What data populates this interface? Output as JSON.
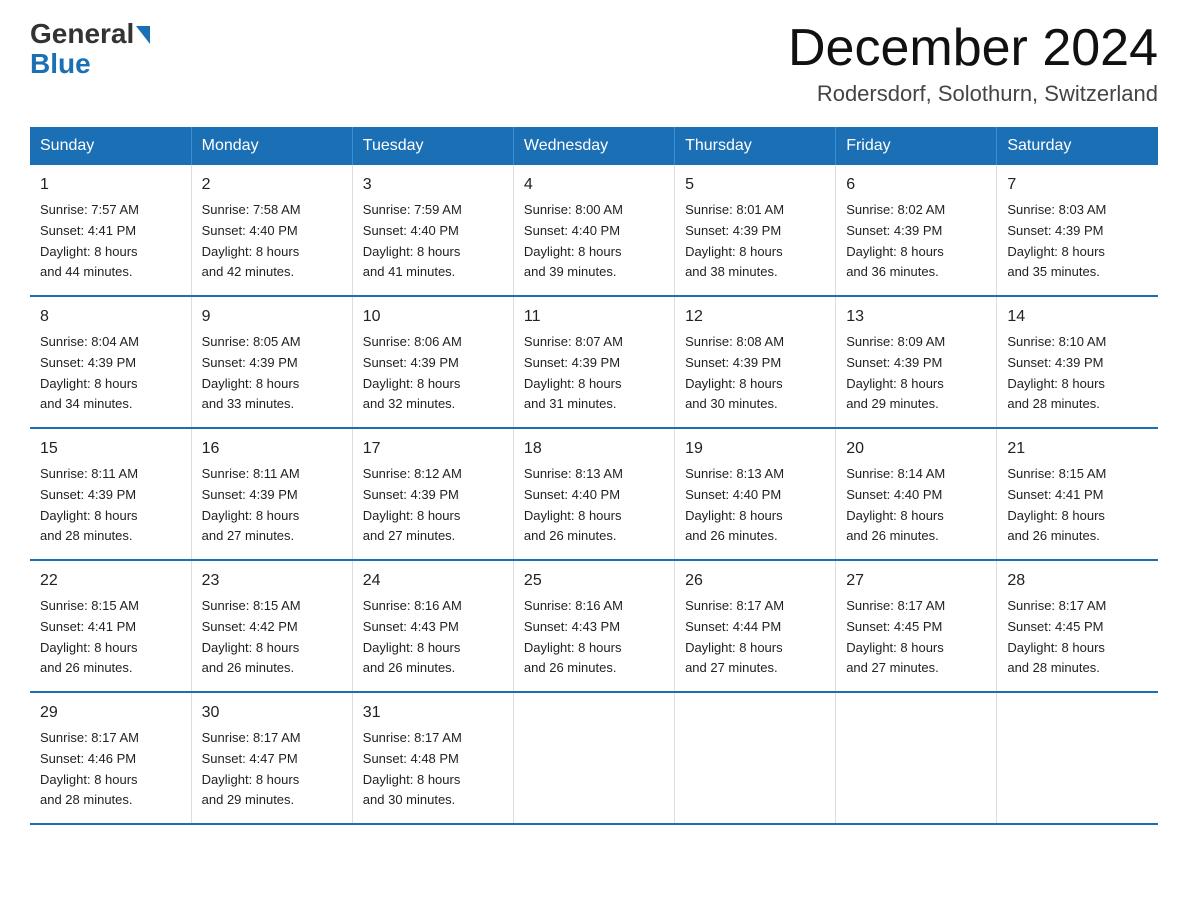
{
  "header": {
    "logo_general": "General",
    "logo_blue": "Blue",
    "month_title": "December 2024",
    "location": "Rodersdorf, Solothurn, Switzerland"
  },
  "columns": [
    "Sunday",
    "Monday",
    "Tuesday",
    "Wednesday",
    "Thursday",
    "Friday",
    "Saturday"
  ],
  "weeks": [
    [
      {
        "day": "1",
        "info": "Sunrise: 7:57 AM\nSunset: 4:41 PM\nDaylight: 8 hours\nand 44 minutes."
      },
      {
        "day": "2",
        "info": "Sunrise: 7:58 AM\nSunset: 4:40 PM\nDaylight: 8 hours\nand 42 minutes."
      },
      {
        "day": "3",
        "info": "Sunrise: 7:59 AM\nSunset: 4:40 PM\nDaylight: 8 hours\nand 41 minutes."
      },
      {
        "day": "4",
        "info": "Sunrise: 8:00 AM\nSunset: 4:40 PM\nDaylight: 8 hours\nand 39 minutes."
      },
      {
        "day": "5",
        "info": "Sunrise: 8:01 AM\nSunset: 4:39 PM\nDaylight: 8 hours\nand 38 minutes."
      },
      {
        "day": "6",
        "info": "Sunrise: 8:02 AM\nSunset: 4:39 PM\nDaylight: 8 hours\nand 36 minutes."
      },
      {
        "day": "7",
        "info": "Sunrise: 8:03 AM\nSunset: 4:39 PM\nDaylight: 8 hours\nand 35 minutes."
      }
    ],
    [
      {
        "day": "8",
        "info": "Sunrise: 8:04 AM\nSunset: 4:39 PM\nDaylight: 8 hours\nand 34 minutes."
      },
      {
        "day": "9",
        "info": "Sunrise: 8:05 AM\nSunset: 4:39 PM\nDaylight: 8 hours\nand 33 minutes."
      },
      {
        "day": "10",
        "info": "Sunrise: 8:06 AM\nSunset: 4:39 PM\nDaylight: 8 hours\nand 32 minutes."
      },
      {
        "day": "11",
        "info": "Sunrise: 8:07 AM\nSunset: 4:39 PM\nDaylight: 8 hours\nand 31 minutes."
      },
      {
        "day": "12",
        "info": "Sunrise: 8:08 AM\nSunset: 4:39 PM\nDaylight: 8 hours\nand 30 minutes."
      },
      {
        "day": "13",
        "info": "Sunrise: 8:09 AM\nSunset: 4:39 PM\nDaylight: 8 hours\nand 29 minutes."
      },
      {
        "day": "14",
        "info": "Sunrise: 8:10 AM\nSunset: 4:39 PM\nDaylight: 8 hours\nand 28 minutes."
      }
    ],
    [
      {
        "day": "15",
        "info": "Sunrise: 8:11 AM\nSunset: 4:39 PM\nDaylight: 8 hours\nand 28 minutes."
      },
      {
        "day": "16",
        "info": "Sunrise: 8:11 AM\nSunset: 4:39 PM\nDaylight: 8 hours\nand 27 minutes."
      },
      {
        "day": "17",
        "info": "Sunrise: 8:12 AM\nSunset: 4:39 PM\nDaylight: 8 hours\nand 27 minutes."
      },
      {
        "day": "18",
        "info": "Sunrise: 8:13 AM\nSunset: 4:40 PM\nDaylight: 8 hours\nand 26 minutes."
      },
      {
        "day": "19",
        "info": "Sunrise: 8:13 AM\nSunset: 4:40 PM\nDaylight: 8 hours\nand 26 minutes."
      },
      {
        "day": "20",
        "info": "Sunrise: 8:14 AM\nSunset: 4:40 PM\nDaylight: 8 hours\nand 26 minutes."
      },
      {
        "day": "21",
        "info": "Sunrise: 8:15 AM\nSunset: 4:41 PM\nDaylight: 8 hours\nand 26 minutes."
      }
    ],
    [
      {
        "day": "22",
        "info": "Sunrise: 8:15 AM\nSunset: 4:41 PM\nDaylight: 8 hours\nand 26 minutes."
      },
      {
        "day": "23",
        "info": "Sunrise: 8:15 AM\nSunset: 4:42 PM\nDaylight: 8 hours\nand 26 minutes."
      },
      {
        "day": "24",
        "info": "Sunrise: 8:16 AM\nSunset: 4:43 PM\nDaylight: 8 hours\nand 26 minutes."
      },
      {
        "day": "25",
        "info": "Sunrise: 8:16 AM\nSunset: 4:43 PM\nDaylight: 8 hours\nand 26 minutes."
      },
      {
        "day": "26",
        "info": "Sunrise: 8:17 AM\nSunset: 4:44 PM\nDaylight: 8 hours\nand 27 minutes."
      },
      {
        "day": "27",
        "info": "Sunrise: 8:17 AM\nSunset: 4:45 PM\nDaylight: 8 hours\nand 27 minutes."
      },
      {
        "day": "28",
        "info": "Sunrise: 8:17 AM\nSunset: 4:45 PM\nDaylight: 8 hours\nand 28 minutes."
      }
    ],
    [
      {
        "day": "29",
        "info": "Sunrise: 8:17 AM\nSunset: 4:46 PM\nDaylight: 8 hours\nand 28 minutes."
      },
      {
        "day": "30",
        "info": "Sunrise: 8:17 AM\nSunset: 4:47 PM\nDaylight: 8 hours\nand 29 minutes."
      },
      {
        "day": "31",
        "info": "Sunrise: 8:17 AM\nSunset: 4:48 PM\nDaylight: 8 hours\nand 30 minutes."
      },
      null,
      null,
      null,
      null
    ]
  ]
}
